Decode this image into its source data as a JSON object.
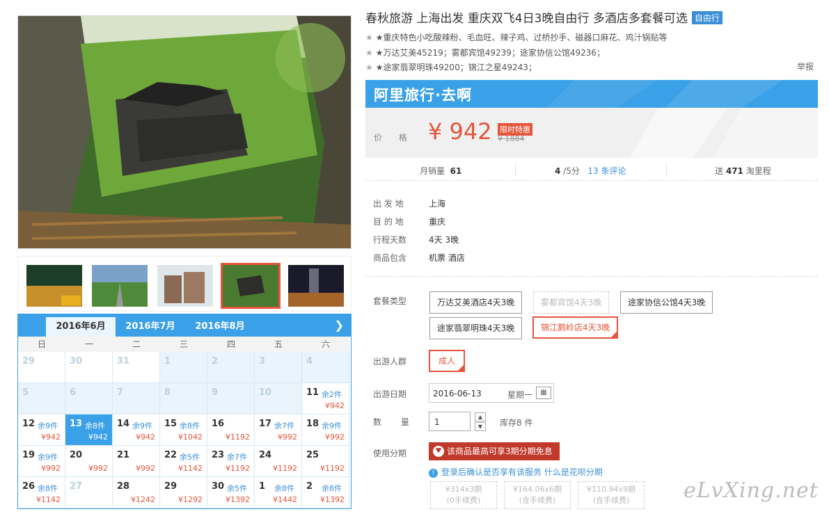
{
  "product": {
    "title": "春秋旅游 上海出发 重庆双飞4日3晚自由行 多酒店多套餐可选",
    "tag": "自由行",
    "features": [
      "★重庆特色小吃酸辣粉、毛血旺、辣子鸡、过桥抄手、磁器口麻花、鸡汁锅贴等",
      "★万达艾美45219；雾都宾馆49239；途家协信公馆49236；",
      "★途家翡翠明珠49200；锦江之星49243；"
    ],
    "report_label": "举报"
  },
  "brand": {
    "name": "阿里旅行·去啊"
  },
  "price": {
    "label": "价 格",
    "current": "¥ 942",
    "promo": "限时特惠",
    "original": "¥ 1884"
  },
  "stats": {
    "monthly_sales_label": "月销量",
    "monthly_sales": "61",
    "rating": "4",
    "rating_suffix": "/5分",
    "reviews": "13 条评论",
    "points_prefix": "送",
    "points": "471",
    "points_suffix": "淘里程"
  },
  "info": [
    {
      "label": "出 发 地",
      "value": "上海"
    },
    {
      "label": "目 的 地",
      "value": "重庆"
    },
    {
      "label": "行程天数",
      "value": "4天 3晚"
    },
    {
      "label": "商品包含",
      "value": "机票  酒店"
    }
  ],
  "options": {
    "package_label": "套餐类型",
    "packages": [
      {
        "label": "万达艾美酒店4天3晚",
        "state": "normal"
      },
      {
        "label": "雾都宾馆4天3晚",
        "state": "disabled"
      },
      {
        "label": "途家协信公馆4天3晚",
        "state": "normal"
      },
      {
        "label": "途家翡翠明珠4天3晚",
        "state": "normal"
      },
      {
        "label": "锦江鹅岭店4天3晚",
        "state": "selected"
      }
    ],
    "traveler_label": "出游人群",
    "traveler": "成人",
    "date_label": "出游日期",
    "date_value": "2016-06-13",
    "date_weekday": "星期一",
    "qty_label": "数 量",
    "qty_value": "1",
    "stock": "库存8 件",
    "installment_label": "使用分期",
    "installment_banner": "该商品最高可享3期分期免息",
    "installment_note": "登录后确认是否享有该服务",
    "installment_link": "什么是花呗分期",
    "installment_options": [
      {
        "line1": "¥314x3期",
        "line2": "(0手续费)"
      },
      {
        "line1": "¥164.06x6期",
        "line2": "(含手续费)"
      },
      {
        "line1": "¥110.94x9期",
        "line2": "(含手续费)"
      }
    ]
  },
  "calendar": {
    "tabs": [
      "2016年6月",
      "2016年7月",
      "2016年8月"
    ],
    "active_tab": 0,
    "weekdays": [
      "日",
      "一",
      "二",
      "三",
      "四",
      "五",
      "六"
    ],
    "weeks": [
      [
        {
          "d": "29",
          "s": "past"
        },
        {
          "d": "30",
          "s": "past"
        },
        {
          "d": "31",
          "s": "past"
        },
        {
          "d": "1",
          "s": "off"
        },
        {
          "d": "2",
          "s": "off"
        },
        {
          "d": "3",
          "s": "off"
        },
        {
          "d": "4",
          "s": "off"
        }
      ],
      [
        {
          "d": "5",
          "s": "off"
        },
        {
          "d": "6",
          "s": "off"
        },
        {
          "d": "7",
          "s": "off"
        },
        {
          "d": "8",
          "s": "off"
        },
        {
          "d": "9",
          "s": "off"
        },
        {
          "d": "10",
          "s": "off"
        },
        {
          "d": "11",
          "s": "av",
          "r": "余2件",
          "p": "¥942"
        }
      ],
      [
        {
          "d": "12",
          "s": "av",
          "r": "余9件",
          "p": "¥942"
        },
        {
          "d": "13",
          "s": "today",
          "r": "余8件",
          "p": "¥942"
        },
        {
          "d": "14",
          "s": "av",
          "r": "余9件",
          "p": "¥942"
        },
        {
          "d": "15",
          "s": "av",
          "r": "余8件",
          "p": "¥1042"
        },
        {
          "d": "16",
          "s": "av",
          "r": "",
          "p": "¥1192"
        },
        {
          "d": "17",
          "s": "av",
          "r": "余7件",
          "p": "¥992"
        },
        {
          "d": "18",
          "s": "av",
          "r": "余9件",
          "p": "¥992"
        }
      ],
      [
        {
          "d": "19",
          "s": "av",
          "r": "余9件",
          "p": "¥992"
        },
        {
          "d": "20",
          "s": "av",
          "r": "",
          "p": "¥992"
        },
        {
          "d": "21",
          "s": "av",
          "r": "",
          "p": "¥992"
        },
        {
          "d": "22",
          "s": "av",
          "r": "余5件",
          "p": "¥1142"
        },
        {
          "d": "23",
          "s": "av",
          "r": "余7件",
          "p": "¥1192"
        },
        {
          "d": "24",
          "s": "av",
          "r": "",
          "p": "¥1192"
        },
        {
          "d": "25",
          "s": "av",
          "r": "",
          "p": "¥1192"
        }
      ],
      [
        {
          "d": "26",
          "s": "av",
          "r": "余8件",
          "p": "¥1142"
        },
        {
          "d": "27",
          "s": "past",
          "r": "",
          "p": ""
        },
        {
          "d": "28",
          "s": "av",
          "r": "",
          "p": "¥1242"
        },
        {
          "d": "29",
          "s": "av",
          "r": "",
          "p": "¥1292"
        },
        {
          "d": "30",
          "s": "av",
          "r": "余5件",
          "p": "¥1392"
        },
        {
          "d": "1",
          "s": "av",
          "r": "余8件",
          "p": "¥1442"
        },
        {
          "d": "2",
          "s": "av",
          "r": "余8件",
          "p": "¥1392"
        }
      ]
    ]
  },
  "watermark": "eLvXing.net",
  "colors": {
    "accent": "#3aa0e7",
    "price_red": "#e5543b",
    "installment_red": "#c0392b"
  }
}
